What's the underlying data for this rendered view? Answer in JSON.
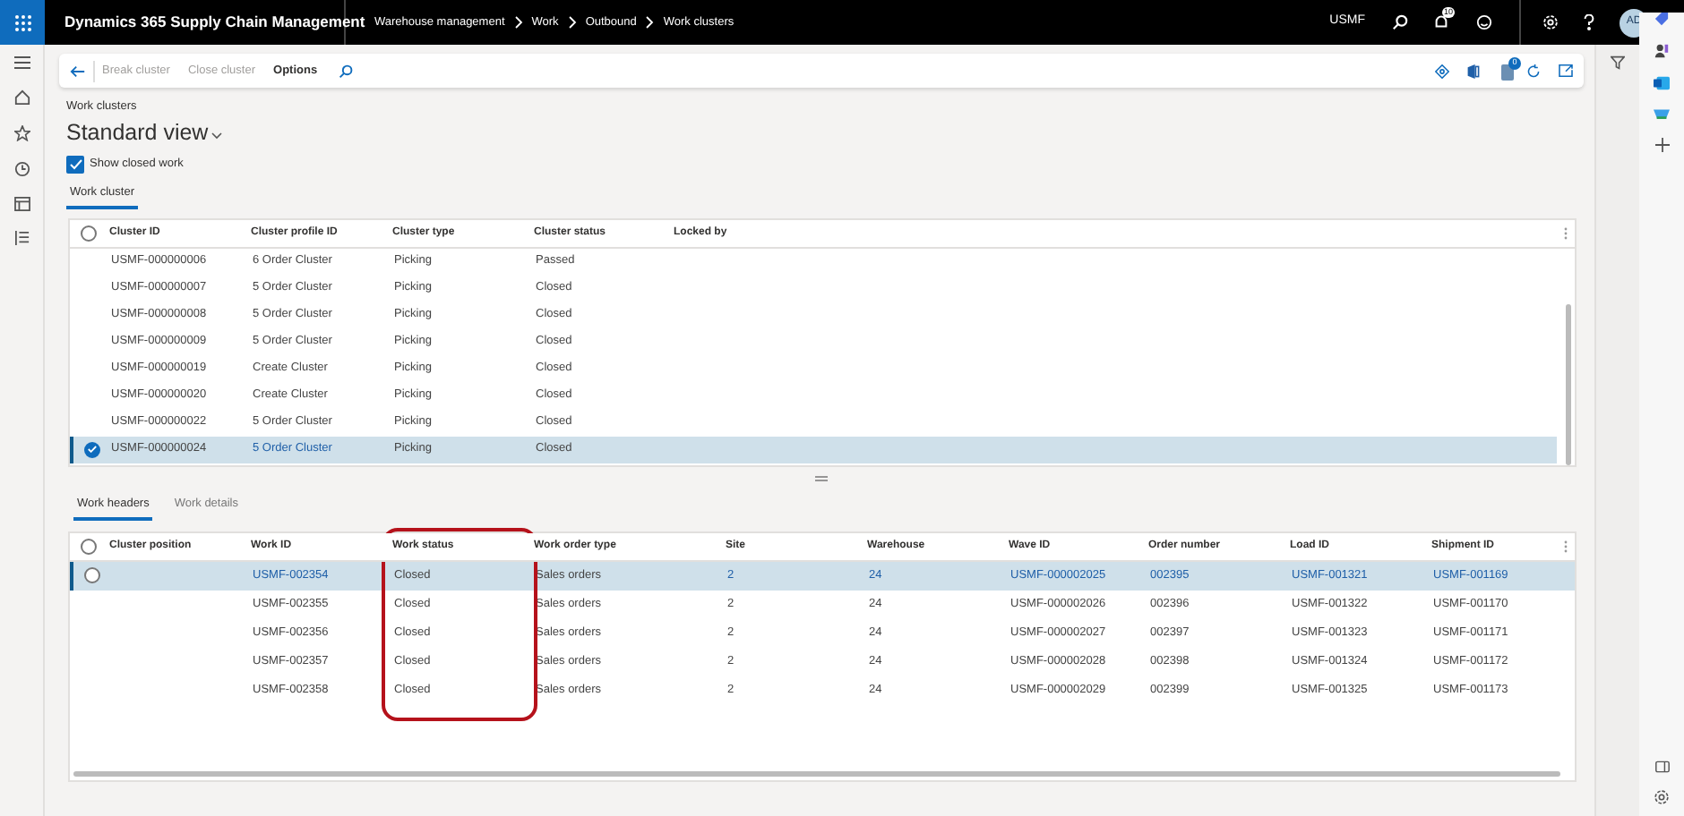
{
  "app_bar": {
    "title": "Dynamics 365 Supply Chain Management",
    "breadcrumbs": [
      "Warehouse management",
      "Work",
      "Outbound",
      "Work clusters"
    ],
    "company": "USMF",
    "notification_count": "10",
    "avatar": "AD"
  },
  "action_bar": {
    "buttons": [
      {
        "label": "Break cluster",
        "disabled": true
      },
      {
        "label": "Close cluster",
        "disabled": true
      },
      {
        "label": "Options",
        "disabled": false
      }
    ],
    "badge": "0"
  },
  "page": {
    "caption": "Work clusters",
    "view": "Standard view",
    "show_closed": {
      "label": "Show closed work",
      "checked": true
    }
  },
  "cluster_tabs": [
    {
      "label": "Work cluster",
      "selected": true
    }
  ],
  "cluster_grid": {
    "columns": [
      {
        "label": "Cluster ID",
        "link": false
      },
      {
        "label": "Cluster profile ID",
        "link": true
      },
      {
        "label": "Cluster type",
        "link": false
      },
      {
        "label": "Cluster status",
        "link": false
      },
      {
        "label": "Locked by"
      }
    ],
    "all_checked": false,
    "rows": [
      {
        "cells": [
          "USMF-000000006",
          "6 Order Cluster",
          "Picking",
          "Passed"
        ],
        "selected": false
      },
      {
        "cells": [
          "USMF-000000007",
          "5 Order Cluster",
          "Picking",
          "Closed"
        ],
        "selected": false
      },
      {
        "cells": [
          "USMF-000000008",
          "5 Order Cluster",
          "Picking",
          "Closed"
        ],
        "selected": false
      },
      {
        "cells": [
          "USMF-000000009",
          "5 Order Cluster",
          "Picking",
          "Closed"
        ],
        "selected": false
      },
      {
        "cells": [
          "USMF-000000019",
          "Create Cluster",
          "Picking",
          "Closed"
        ],
        "selected": false
      },
      {
        "cells": [
          "USMF-000000020",
          "Create Cluster",
          "Picking",
          "Closed"
        ],
        "selected": false
      },
      {
        "cells": [
          "USMF-000000022",
          "5 Order Cluster",
          "Picking",
          "Closed"
        ],
        "selected": false
      },
      {
        "cells": [
          "USMF-000000024",
          "5 Order Cluster",
          "Picking",
          "Closed"
        ],
        "selected": true,
        "checked": true
      }
    ]
  },
  "detail_tabs": [
    {
      "label": "Work headers",
      "selected": true
    },
    {
      "label": "Work details",
      "selected": false
    }
  ],
  "work_grid": {
    "columns": [
      {
        "label": "Cluster position"
      },
      {
        "label": "Work ID",
        "link": true
      },
      {
        "label": "Work status",
        "link": false,
        "highlighted": true
      },
      {
        "label": "Work order type",
        "link": false
      },
      {
        "label": "Site",
        "link": true
      },
      {
        "label": "Warehouse",
        "link": true
      },
      {
        "label": "Wave ID",
        "link": true
      },
      {
        "label": "Order number",
        "link": true
      },
      {
        "label": "Load ID",
        "link": true
      },
      {
        "label": "Shipment ID",
        "link": true
      }
    ],
    "all_checked": false,
    "rows": [
      {
        "cells": [
          "",
          "USMF-002354",
          "Closed",
          "Sales orders",
          "2",
          "24",
          "USMF-000002025",
          "002395",
          "USMF-001321",
          "USMF-001169"
        ],
        "selected": true,
        "checked": false
      },
      {
        "cells": [
          "",
          "USMF-002355",
          "Closed",
          "Sales orders",
          "2",
          "24",
          "USMF-000002026",
          "002396",
          "USMF-001322",
          "USMF-001170"
        ],
        "selected": false
      },
      {
        "cells": [
          "",
          "USMF-002356",
          "Closed",
          "Sales orders",
          "2",
          "24",
          "USMF-000002027",
          "002397",
          "USMF-001323",
          "USMF-001171"
        ],
        "selected": false
      },
      {
        "cells": [
          "",
          "USMF-002357",
          "Closed",
          "Sales orders",
          "2",
          "24",
          "USMF-000002028",
          "002398",
          "USMF-001324",
          "USMF-001172"
        ],
        "selected": false
      },
      {
        "cells": [
          "",
          "USMF-002358",
          "Closed",
          "Sales orders",
          "2",
          "24",
          "USMF-000002029",
          "002399",
          "USMF-001325",
          "USMF-001173"
        ],
        "selected": false
      }
    ]
  }
}
